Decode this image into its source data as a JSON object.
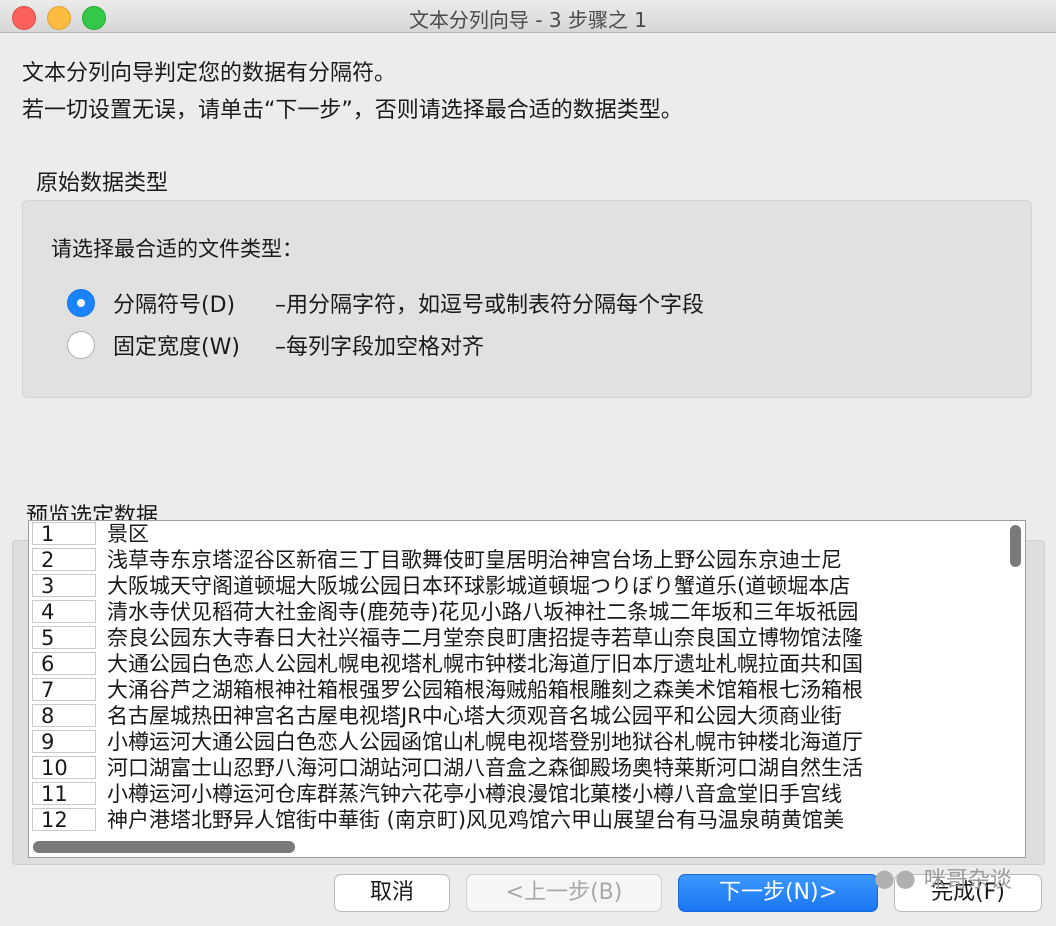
{
  "window": {
    "title": "文本分列向导 - 3 步骤之 1"
  },
  "intro": {
    "line1": "文本分列向导判定您的数据有分隔符。",
    "line2": "若一切设置无误，请单击“下一步”，否则请选择最合适的数据类型。"
  },
  "original_type": {
    "section_title": "原始数据类型",
    "prompt": "请选择最合适的文件类型：",
    "options": [
      {
        "label": "分隔符号(D)",
        "description": "–用分隔字符，如逗号或制表符分隔每个字段",
        "selected": true
      },
      {
        "label": "固定宽度(W)",
        "description": "–每列字段加空格对齐",
        "selected": false
      }
    ]
  },
  "preview": {
    "title": "预览选定数据",
    "rows": [
      {
        "num": "1",
        "text": "景区"
      },
      {
        "num": "2",
        "text": "浅草寺东京塔涩谷区新宿三丁目歌舞伎町皇居明治神宫台场上野公园东京迪士尼"
      },
      {
        "num": "3",
        "text": "大阪城天守阁道顿堀大阪城公园日本环球影城道頓堀つりぼり蟹道乐(道顿堀本店"
      },
      {
        "num": "4",
        "text": "清水寺伏见稻荷大社金阁寺(鹿苑寺)花见小路八坂神社二条城二年坂和三年坂祇园"
      },
      {
        "num": "5",
        "text": "奈良公园东大寺春日大社兴福寺二月堂奈良町唐招提寺若草山奈良国立博物馆法隆"
      },
      {
        "num": "6",
        "text": "大通公园白色恋人公园札幌电视塔札幌市钟楼北海道厅旧本厅遗址札幌拉面共和国"
      },
      {
        "num": "7",
        "text": "大涌谷芦之湖箱根神社箱根强罗公园箱根海贼船箱根雕刻之森美术馆箱根七汤箱根"
      },
      {
        "num": "8",
        "text": "名古屋城热田神宫名古屋电视塔JR中心塔大须观音名城公园平和公园大须商业街"
      },
      {
        "num": "9",
        "text": "小樽运河大通公园白色恋人公园函馆山札幌电视塔登别地狱谷札幌市钟楼北海道厅"
      },
      {
        "num": "10",
        "text": "河口湖富士山忍野八海河口湖站河口湖八音盒之森御殿场奥特莱斯河口湖自然生活"
      },
      {
        "num": "11",
        "text": "小樽运河小樽运河仓库群蒸汽钟六花亭小樽浪漫馆北菓楼小樽八音盒堂旧手宫线"
      },
      {
        "num": "12",
        "text": "神户港塔北野异人馆街中華街 (南京町)风见鸡馆六甲山展望台有马温泉萌黄馆美"
      }
    ]
  },
  "buttons": {
    "cancel": "取消",
    "prev": "<上一步(B)",
    "next": "下一步(N)>",
    "finish": "完成(F)"
  },
  "watermark": {
    "text": "咪哥杂谈",
    "icon": "wechat-icon"
  }
}
